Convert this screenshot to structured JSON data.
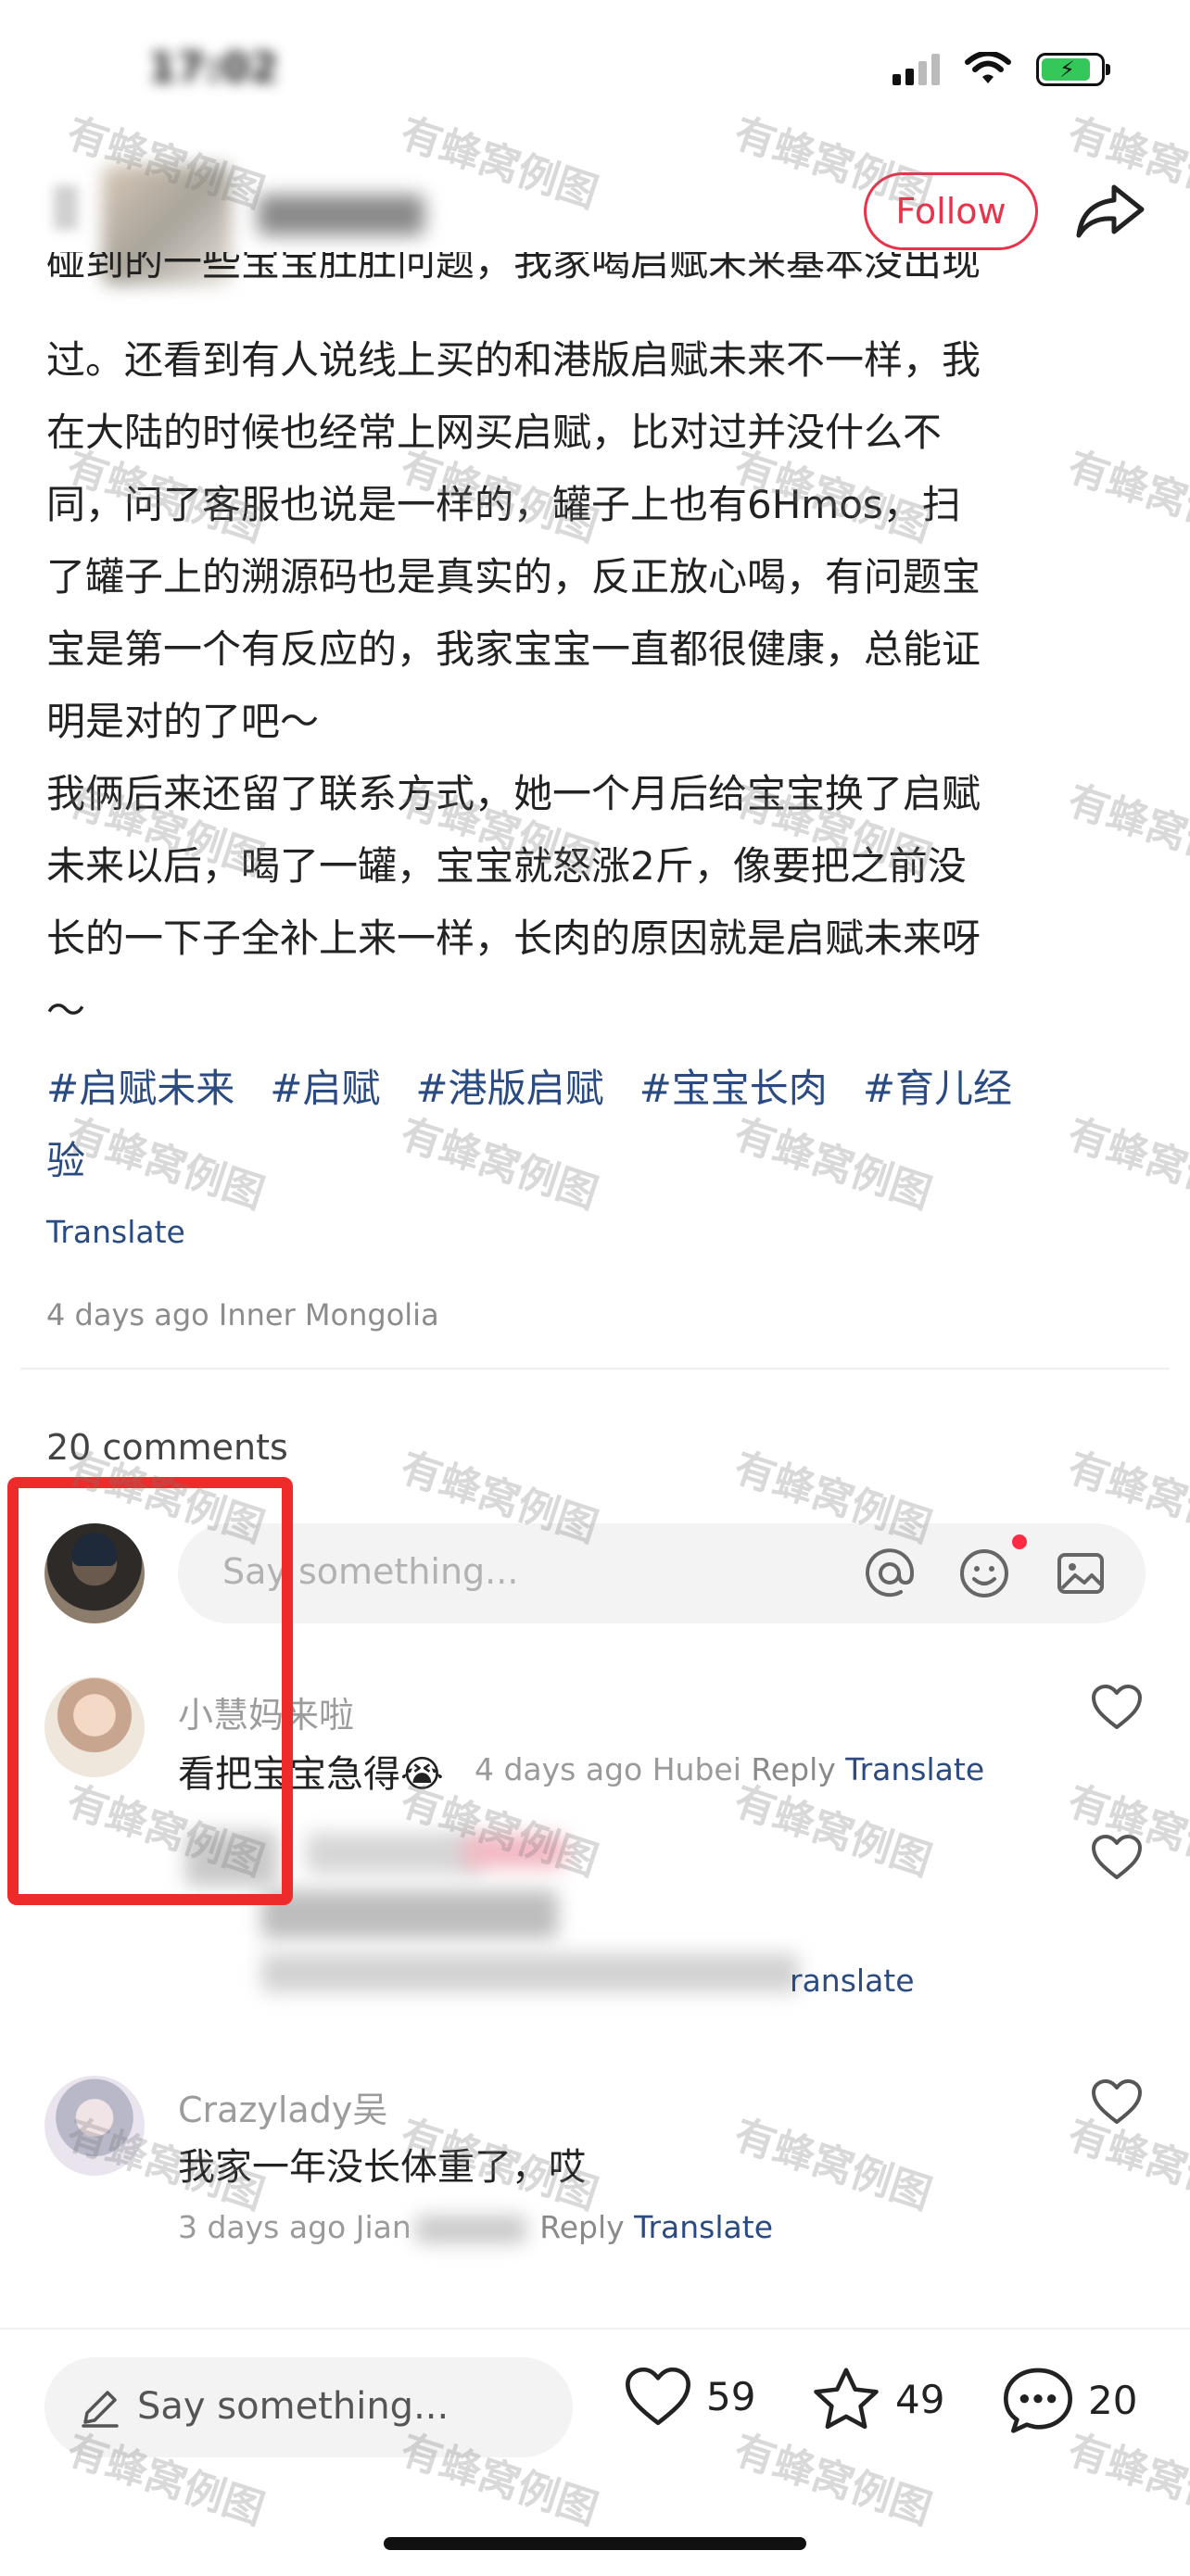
{
  "status_bar": {
    "time": "17:02"
  },
  "header": {
    "follow_label": "Follow"
  },
  "post": {
    "paragraphs": [
      "碰到的一些宝宝肚肚问题，我家喝启赋未来基本没出现",
      "过。还看到有人说线上买的和港版启赋未来不一样，我",
      "在大陆的时候也经常上网买启赋，比对过并没什么不",
      "同，问了客服也说是一样的，罐子上也有6Hmos，扫",
      "了罐子上的溯源码也是真实的，反正放心喝，有问题宝",
      "宝是第一个有反应的，我家宝宝一直都很健康，总能证",
      "明是对的了吧～",
      "我俩后来还留了联系方式，她一个月后给宝宝换了启赋",
      "未来以后，喝了一罐，宝宝就怒涨2斤，像要把之前没",
      "长的一下子全补上来一样，长肉的原因就是启赋未来呀",
      "～"
    ],
    "tags": [
      "#启赋未来",
      "#启赋",
      "#港版启赋",
      "#宝宝长肉",
      "#育儿经",
      "验"
    ],
    "translate_label": "Translate",
    "meta": "4 days ago Inner Mongolia"
  },
  "comments_section": {
    "count_label": "20 comments",
    "input_placeholder": "Say something...",
    "comments": [
      {
        "name": "小慧妈来啦",
        "text": "看把宝宝急得",
        "emoji": "😭",
        "time_loc": "4 days ago Hubei",
        "reply": "Reply",
        "translate": "Translate"
      },
      {
        "translate_partial": "ranslate"
      },
      {
        "name": "Crazylady吴",
        "text": "我家一年没长体重了，哎",
        "time_loc": "3 days ago Jian",
        "reply": "Reply",
        "translate": "Translate"
      }
    ]
  },
  "bottom_bar": {
    "placeholder": "Say something...",
    "likes": "59",
    "collects": "49",
    "comments": "20"
  },
  "watermark": "有蜂窝例图",
  "colors": {
    "accent": "#e8334a",
    "link": "#2a4a82",
    "highlight": "#ee2b2b",
    "notify_dot": "#ff2b45"
  }
}
